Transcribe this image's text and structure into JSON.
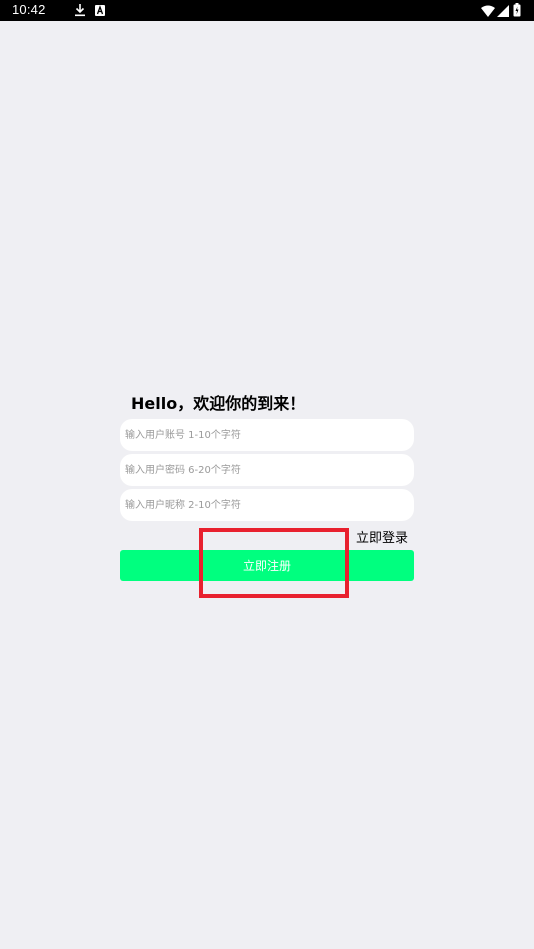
{
  "status_bar": {
    "time": "10:42",
    "icons": [
      "download-icon",
      "a-icon",
      "wifi-icon",
      "signal-icon",
      "battery-icon"
    ]
  },
  "form": {
    "greeting": "Hello，欢迎你的到来！",
    "username_placeholder": "输入用户账号 1-10个字符",
    "password_placeholder": "输入用户密码 6-20个字符",
    "nickname_placeholder": "输入用户昵称 2-10个字符",
    "login_link": "立即登录",
    "register_button": "立即注册"
  },
  "colors": {
    "background": "#efeff3",
    "accent": "#00ff7f",
    "highlight": "#e8202e"
  }
}
